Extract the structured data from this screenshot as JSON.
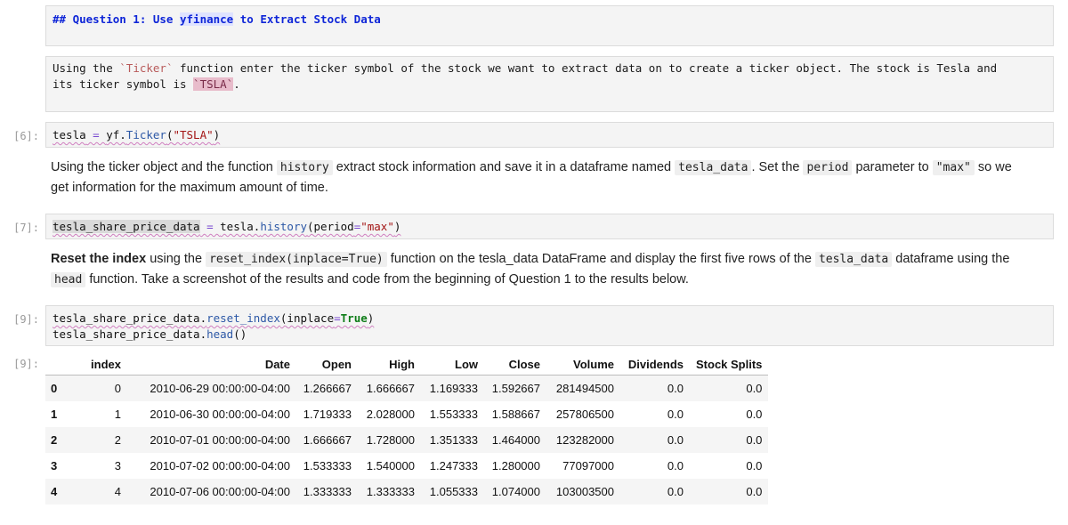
{
  "cell_markdown_header": {
    "prefix": "## Question 1: Use ",
    "highlight": "yfinance",
    "suffix": " to Extract Stock Data"
  },
  "cell_markdown_ticker": {
    "line1_a": "Using the ",
    "line1_code": "`Ticker`",
    "line1_b": " function enter the ticker symbol of the stock we want to extract data on to create a ticker object. The stock is Tesla and",
    "line2_a": "its ticker symbol is ",
    "line2_code": "`TSLA`",
    "line2_b": "."
  },
  "cell6": {
    "prompt": "[6]:",
    "var": "tesla",
    "op": " = ",
    "obj": "yf.",
    "fn": "Ticker",
    "open": "(",
    "str": "\"TSLA\"",
    "close": ")"
  },
  "md_history": {
    "t1": "Using the ticker object and the function ",
    "c1": "history",
    "t2": " extract stock information and save it in a dataframe named ",
    "c2": "tesla_data",
    "t3": ". Set the ",
    "c3": "period",
    "t4": " parameter to ",
    "c4": "\"max\"",
    "t5": " so we get information for the maximum amount of time."
  },
  "cell7": {
    "prompt": "[7]:",
    "var": "tesla_share_price_data",
    "op": " = ",
    "obj": "tesla.",
    "fn": "history",
    "open": "(",
    "arg": "period",
    "eq": "=",
    "str": "\"max\"",
    "close": ")"
  },
  "md_reset": {
    "bold": "Reset the index",
    "t1": " using the ",
    "c1": "reset_index(inplace=True)",
    "t2": " function on the tesla_data DataFrame and display the first five rows of the ",
    "c2": "tesla_data",
    "t3": " dataframe using the ",
    "c3": "head",
    "t4": " function. Take a screenshot of the results and code from the beginning of Question 1 to the results below."
  },
  "cell9": {
    "prompt": "[9]:",
    "l1_obj": "tesla_share_price_data.",
    "l1_fn": "reset_index",
    "l1_open": "(",
    "l1_arg": "inplace",
    "l1_eq": "=",
    "l1_val": "True",
    "l1_close": ")",
    "l2_obj": "tesla_share_price_data.",
    "l2_fn": "head",
    "l2_call": "()"
  },
  "output9": {
    "prompt": "[9]:",
    "columns": [
      "",
      "index",
      "Date",
      "Open",
      "High",
      "Low",
      "Close",
      "Volume",
      "Dividends",
      "Stock Splits"
    ],
    "rows": [
      [
        "0",
        "0",
        "2010-06-29 00:00:00-04:00",
        "1.266667",
        "1.666667",
        "1.169333",
        "1.592667",
        "281494500",
        "0.0",
        "0.0"
      ],
      [
        "1",
        "1",
        "2010-06-30 00:00:00-04:00",
        "1.719333",
        "2.028000",
        "1.553333",
        "1.588667",
        "257806500",
        "0.0",
        "0.0"
      ],
      [
        "2",
        "2",
        "2010-07-01 00:00:00-04:00",
        "1.666667",
        "1.728000",
        "1.351333",
        "1.464000",
        "123282000",
        "0.0",
        "0.0"
      ],
      [
        "3",
        "3",
        "2010-07-02 00:00:00-04:00",
        "1.533333",
        "1.540000",
        "1.247333",
        "1.280000",
        "77097000",
        "0.0",
        "0.0"
      ],
      [
        "4",
        "4",
        "2010-07-06 00:00:00-04:00",
        "1.333333",
        "1.333333",
        "1.055333",
        "1.074000",
        "103003500",
        "0.0",
        "0.0"
      ]
    ]
  }
}
